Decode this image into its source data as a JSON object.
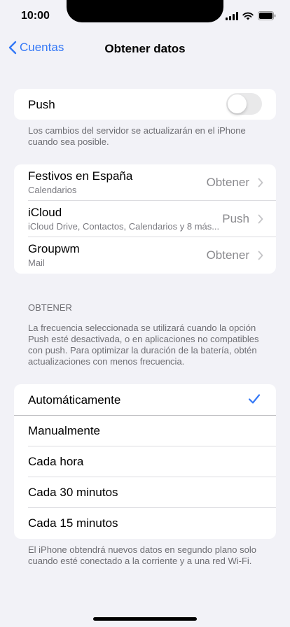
{
  "status_bar": {
    "time": "10:00"
  },
  "nav": {
    "back_label": "Cuentas",
    "title": "Obtener datos"
  },
  "push": {
    "label": "Push",
    "enabled": false,
    "footer": "Los cambios del servidor se actualizarán en el iPhone cuando sea posible."
  },
  "accounts": [
    {
      "name": "Festivos en España",
      "detail": "Calendarios",
      "value": "Obtener"
    },
    {
      "name": "iCloud",
      "detail": "iCloud Drive, Contactos, Calendarios y 8 más...",
      "value": "Push"
    },
    {
      "name": "Groupwm",
      "detail": "Mail",
      "value": "Obtener"
    }
  ],
  "fetch": {
    "header": "OBTENER",
    "description": "La frecuencia seleccionada se utilizará cuando la opción Push esté desactivada, o en aplicaciones no compatibles con push. Para optimizar la duración de la batería, obtén actualizaciones con menos frecuencia.",
    "options": [
      "Automáticamente",
      "Manualmente",
      "Cada hora",
      "Cada 30 minutos",
      "Cada 15 minutos"
    ],
    "selected": "Automáticamente",
    "footer": "El iPhone obtendrá nuevos datos en segundo plano solo cuando esté conectado a la corriente y a una red Wi-Fi."
  },
  "colors": {
    "accent": "#3478f6",
    "background": "#f2f2f7"
  }
}
